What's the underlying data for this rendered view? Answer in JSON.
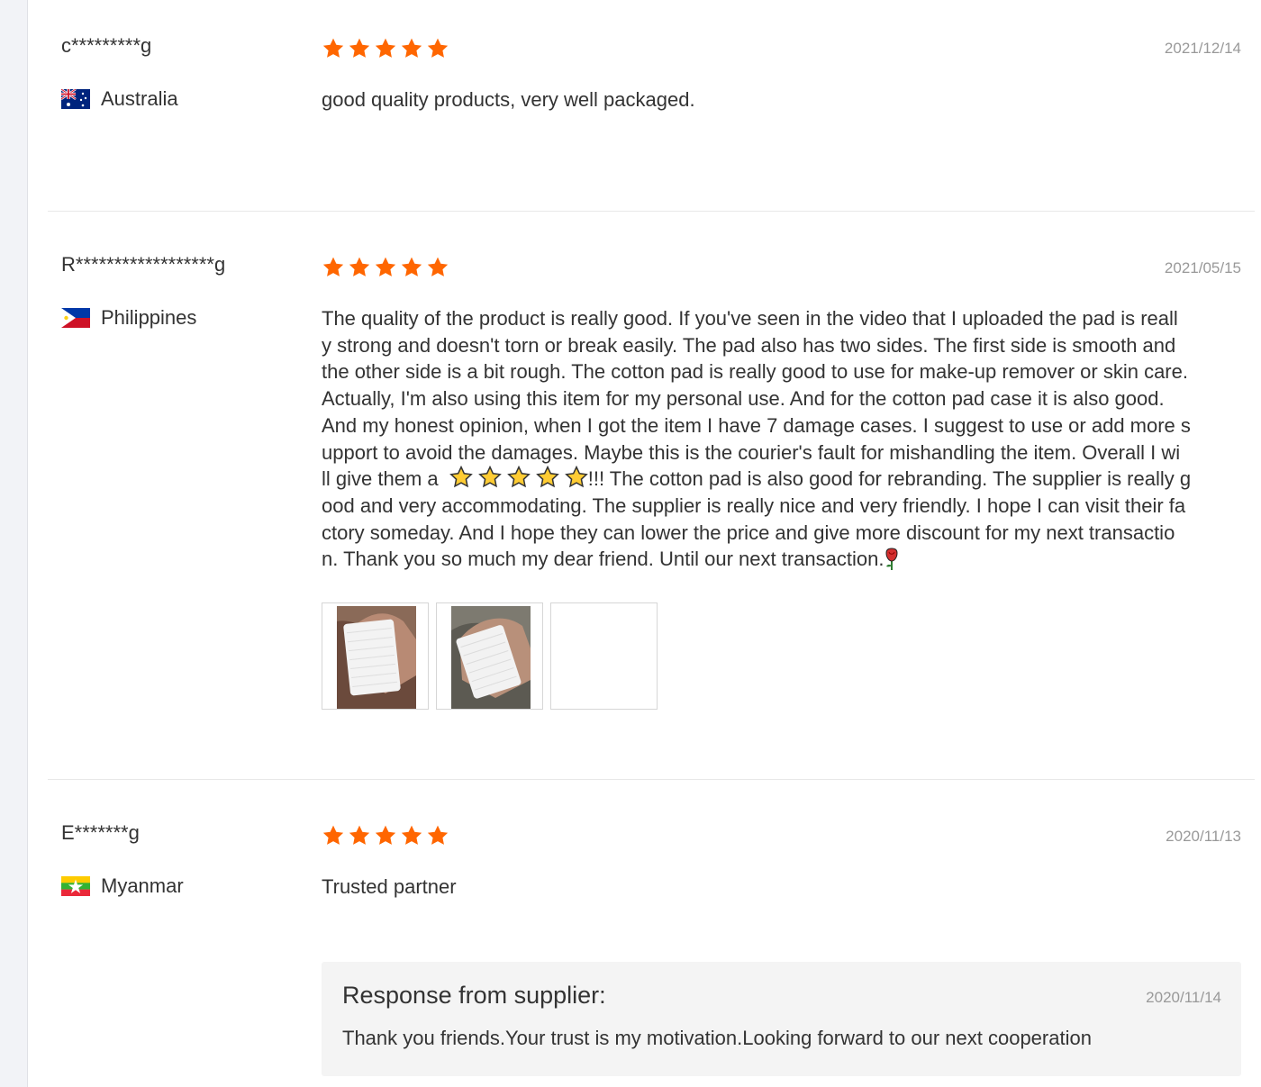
{
  "colors": {
    "star": "#ff6600",
    "gutter": "#f2f3f7",
    "divider": "#e8e8e8",
    "response_bg": "#f4f4f4"
  },
  "reviews": [
    {
      "user": "c*********g",
      "country": "Australia",
      "flag_icon": "australia-flag-icon",
      "rating": 5,
      "date": "2021/12/14",
      "text": "good quality products, very well packaged."
    },
    {
      "user": "R******************g",
      "country": "Philippines",
      "flag_icon": "philippines-flag-icon",
      "rating": 5,
      "date": "2021/05/15",
      "text_lines": [
        "The quality of the product is really good. If you've seen in the video that I uploaded the pad is reall",
        "y strong and doesn't torn or break easily. The pad also has two sides. The first side is smooth and",
        "the other side is a bit rough. The cotton pad is really good to use for make-up remover or skin care.",
        "Actually, I'm also using this item for my personal use. And for the cotton pad case it is also good.",
        "And my honest opinion, when I got the item I have 7 damage cases. I suggest to use or add more s",
        "upport to avoid the damages. Maybe this is the courier's fault for mishandling the item. Overall I wi"
      ],
      "line7_before": "ll give them a",
      "line7_after": "!!! The cotton pad is also good for rebranding. The supplier is really g",
      "text_lines_after": [
        "ood and very accommodating. The supplier is really nice and very friendly. I hope I can visit their fa",
        "ctory someday. And I hope they can lower the price and give more discount for my next transactio"
      ],
      "last_line": "n. Thank you so much my dear friend. Until our next transaction.",
      "photos": [
        "cotton-pad-photo",
        "cotton-pad-photo",
        "empty-photo"
      ]
    },
    {
      "user": "E*******g",
      "country": "Myanmar",
      "flag_icon": "myanmar-flag-icon",
      "rating": 5,
      "date": "2020/11/13",
      "text": "Trusted partner",
      "response": {
        "title": "Response from supplier:",
        "date": "2020/11/14",
        "text": "Thank you friends.Your trust is my motivation.Looking forward to our next cooperation"
      }
    }
  ]
}
